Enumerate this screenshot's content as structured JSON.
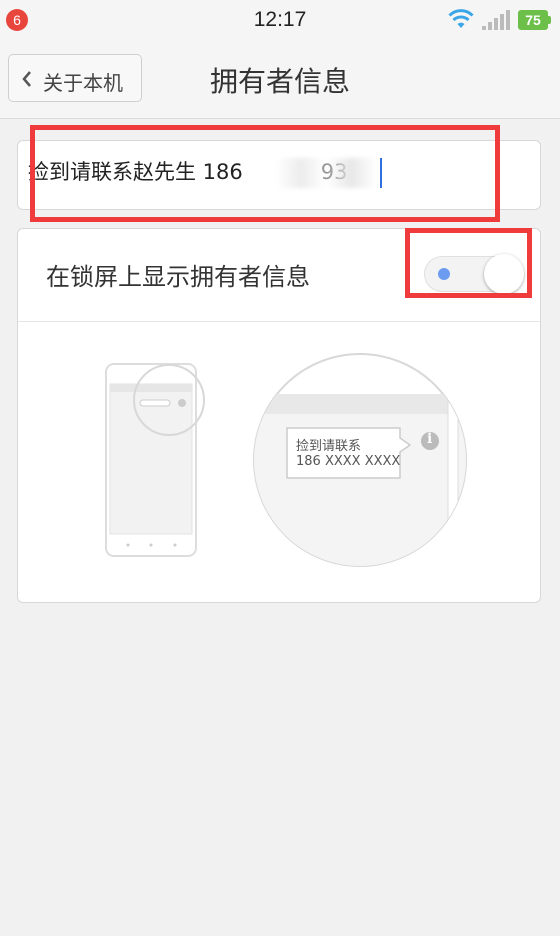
{
  "status_bar": {
    "notification_count": "6",
    "time": "12:17",
    "battery_level": "75",
    "icons": [
      "wifi-icon",
      "signal-icon",
      "battery-icon"
    ],
    "battery_color": "#6cc04a",
    "badge_color": "#e8453c"
  },
  "header": {
    "back_label": "关于本机",
    "title": "拥有者信息"
  },
  "owner_info": {
    "value": "捡到请联系赵先生 186",
    "value_tail": "93"
  },
  "lockscreen_toggle": {
    "label": "在锁屏上显示拥有者信息",
    "enabled": true,
    "accent_color": "#6b9cf0"
  },
  "illustration": {
    "bubble_line1": "捡到请联系",
    "bubble_line2": "186 XXXX XXXX",
    "info_icon": "i"
  },
  "highlight_color": "#ef3b3b"
}
